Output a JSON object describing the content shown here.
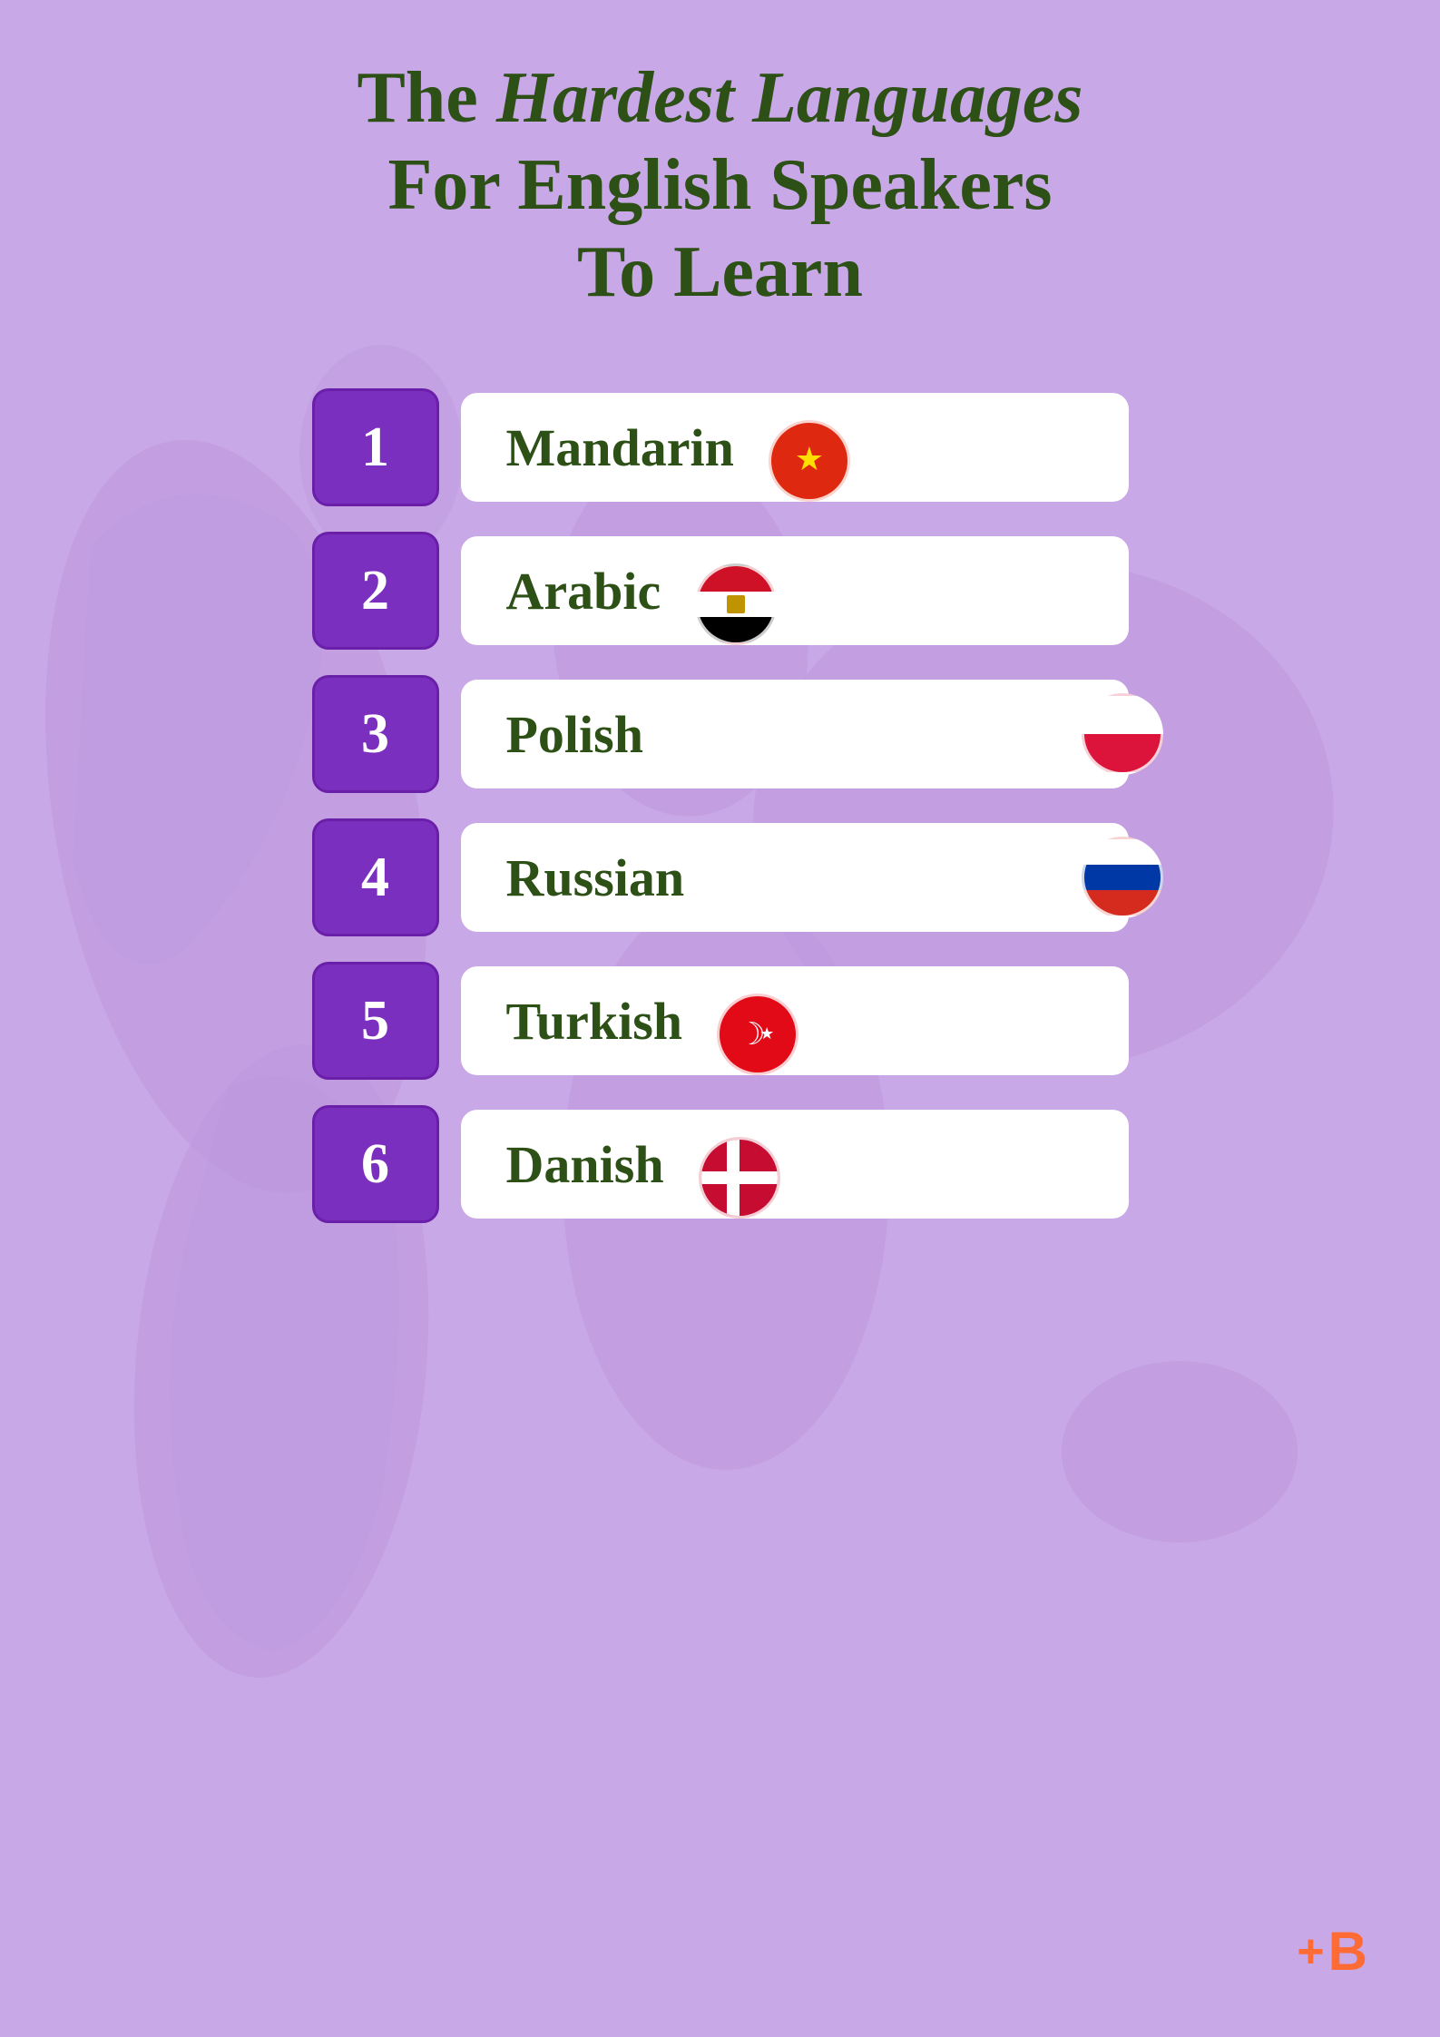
{
  "title": {
    "line1_normal": "The ",
    "line1_italic": "Hardest Languages",
    "line2": "For English Speakers",
    "line3": "To Learn"
  },
  "languages": [
    {
      "rank": "1",
      "name": "Mandarin",
      "flag": "china"
    },
    {
      "rank": "2",
      "name": "Arabic",
      "flag": "egypt"
    },
    {
      "rank": "3",
      "name": "Polish",
      "flag": "poland"
    },
    {
      "rank": "4",
      "name": "Russian",
      "flag": "russia"
    },
    {
      "rank": "5",
      "name": "Turkish",
      "flag": "turkey"
    },
    {
      "rank": "6",
      "name": "Danish",
      "flag": "denmark"
    }
  ],
  "branding": {
    "symbol": "+B"
  },
  "colors": {
    "background": "#c9a8e8",
    "number_box": "#7b2fbe",
    "title_text": "#2d5016",
    "language_text": "#2d5016",
    "brand_color": "#ff6b35"
  }
}
